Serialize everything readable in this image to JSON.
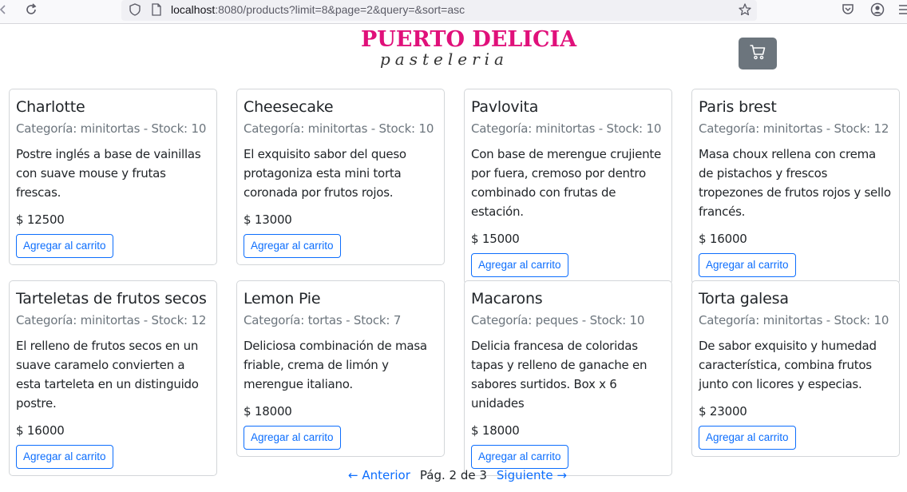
{
  "browser": {
    "url_host": "localhost",
    "url_rest": ":8080/products?limit=8&page=2&query=&sort=asc",
    "back_icon": "arrow-left-icon",
    "reload_icon": "reload-icon"
  },
  "header": {
    "brand_title": "PUERTO DELICIA",
    "brand_subtitle": "pasteleria",
    "cart_icon": "cart-icon",
    "colors": {
      "brand": "#e0107a",
      "cart_bg": "#6c757d"
    }
  },
  "products": [
    {
      "name": "Charlotte",
      "meta": "Categoría: minitortas - Stock: 10",
      "description": "Postre inglés a base de vainillas con suave mouse y frutas frescas.",
      "price": "$ 12500",
      "button": "Agregar al carrito"
    },
    {
      "name": "Cheesecake",
      "meta": "Categoría: minitortas - Stock: 10",
      "description": "El exquisito sabor del queso protagoniza esta mini torta coronada por frutos rojos.",
      "price": "$ 13000",
      "button": "Agregar al carrito"
    },
    {
      "name": "Pavlovita",
      "meta": "Categoría: minitortas - Stock: 10",
      "description": "Con base de merengue crujiente por fuera, cremoso por dentro combinado con frutas de estación.",
      "price": "$ 15000",
      "button": "Agregar al carrito"
    },
    {
      "name": "Paris brest",
      "meta": "Categoría: minitortas - Stock: 12",
      "description": "Masa choux rellena con crema de pistachos y frescos tropezones de frutos rojos y sello francés.",
      "price": "$ 16000",
      "button": "Agregar al carrito"
    },
    {
      "name": "Tarteletas de frutos secos",
      "meta": "Categoría: minitortas - Stock: 12",
      "description": "El relleno de frutos secos en un suave caramelo convierten a esta tarteleta en un distinguido postre.",
      "price": "$ 16000",
      "button": "Agregar al carrito"
    },
    {
      "name": "Lemon Pie",
      "meta": "Categoría: tortas - Stock: 7",
      "description": "Deliciosa combinación de masa friable, crema de limón y merengue italiano.",
      "price": "$ 18000",
      "button": "Agregar al carrito"
    },
    {
      "name": "Macarons",
      "meta": "Categoría: peques - Stock: 10",
      "description": "Delicia francesa de coloridas tapas y relleno de ganache en sabores surtidos. Box x 6 unidades",
      "price": "$ 18000",
      "button": "Agregar al carrito"
    },
    {
      "name": "Torta galesa",
      "meta": "Categoría: minitortas - Stock: 10",
      "description": "De sabor exquisito y humedad característica, combina frutos junto con licores y especias.",
      "price": "$ 23000",
      "button": "Agregar al carrito"
    }
  ],
  "pagination": {
    "prev": "← Anterior",
    "info": "Pág. 2 de 3",
    "next": "Siguiente →"
  }
}
